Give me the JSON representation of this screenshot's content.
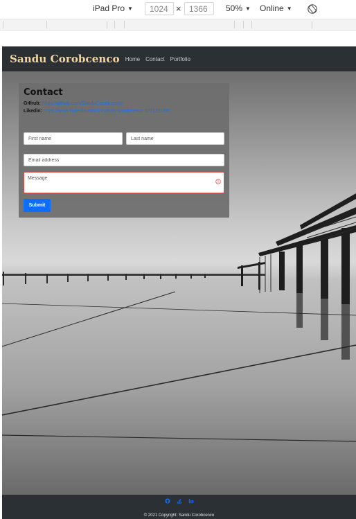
{
  "devtools": {
    "device": "iPad Pro",
    "width": "1024",
    "height": "1366",
    "zoom": "50%",
    "network": "Online",
    "times": "×"
  },
  "site": {
    "brand": "Sandu Corobcenco",
    "nav": [
      "Home",
      "Contact",
      "Portfolio"
    ]
  },
  "contact": {
    "title": "Contact",
    "github_label": "Github:",
    "github_url": "https://github.com/SanduCorobcenco/",
    "linkedin_label": "Likedin:",
    "linkedin_url": "https://www.linkedin.com/in/sandu-corobcenco-527131165/",
    "first_name_placeholder": "First name",
    "last_name_placeholder": "Last name",
    "email_placeholder": "Email address",
    "message_placeholder": "Message",
    "submit_label": "Submit"
  },
  "footer": {
    "icons": [
      "github-icon",
      "stackoverflow-icon",
      "linkedin-icon"
    ],
    "copyright": "© 2021 Copyright: Sandu Corobcenco"
  },
  "colors": {
    "navbar": "#2b3035",
    "brand": "#f4d6a4",
    "link": "#1f6fe0",
    "submit": "#0d6efd",
    "error": "#d9534f"
  }
}
